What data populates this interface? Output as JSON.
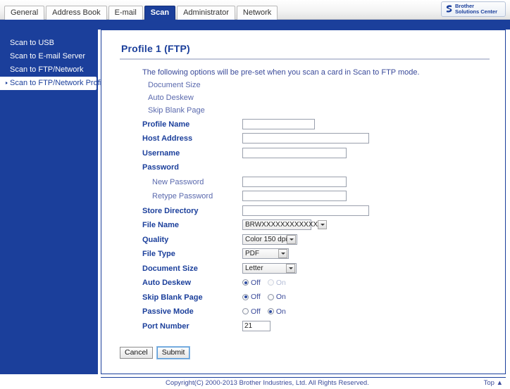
{
  "header": {
    "tabs": [
      {
        "label": "General",
        "active": false
      },
      {
        "label": "Address Book",
        "active": false
      },
      {
        "label": "E-mail",
        "active": false
      },
      {
        "label": "Scan",
        "active": true
      },
      {
        "label": "Administrator",
        "active": false
      },
      {
        "label": "Network",
        "active": false
      }
    ],
    "logo": {
      "line1": "Brother",
      "line2": "Solutions Center"
    }
  },
  "sidebar": {
    "items": [
      {
        "label": "Scan to USB",
        "active": false
      },
      {
        "label": "Scan to E-mail Server",
        "active": false
      },
      {
        "label": "Scan to FTP/Network",
        "active": false
      },
      {
        "label": "Scan to FTP/Network Profile",
        "active": true
      }
    ]
  },
  "main": {
    "title": "Profile 1 (FTP)",
    "intro": "The following options will be pre-set when you scan a card in Scan to FTP mode.",
    "intro_items": [
      "Document Size",
      "Auto Deskew",
      "Skip Blank Page"
    ],
    "fields": {
      "profile_name": {
        "label": "Profile Name",
        "value": "",
        "placeholder": ""
      },
      "host_address": {
        "label": "Host Address",
        "value": "",
        "placeholder": ""
      },
      "username": {
        "label": "Username",
        "value": "",
        "placeholder": ""
      },
      "password": {
        "label": "Password"
      },
      "new_password": {
        "label": "New Password",
        "value": "",
        "placeholder": ""
      },
      "retype_password": {
        "label": "Retype Password",
        "value": "",
        "placeholder": ""
      },
      "store_directory": {
        "label": "Store Directory",
        "value": "",
        "placeholder": ""
      },
      "file_name": {
        "label": "File Name",
        "value": "BRWXXXXXXXXXXXX"
      },
      "quality": {
        "label": "Quality",
        "value": "Color 150 dpi"
      },
      "file_type": {
        "label": "File Type",
        "value": "PDF"
      },
      "document_size": {
        "label": "Document Size",
        "value": "Letter"
      },
      "auto_deskew": {
        "label": "Auto Deskew",
        "off_label": "Off",
        "on_label": "On",
        "selected": "Off",
        "on_disabled": true
      },
      "skip_blank_page": {
        "label": "Skip Blank Page",
        "off_label": "Off",
        "on_label": "On",
        "selected": "Off",
        "on_disabled": false
      },
      "passive_mode": {
        "label": "Passive Mode",
        "off_label": "Off",
        "on_label": "On",
        "selected": "On",
        "on_disabled": false
      },
      "port_number": {
        "label": "Port Number",
        "value": "21",
        "placeholder": ""
      }
    },
    "buttons": {
      "cancel": "Cancel",
      "submit": "Submit"
    }
  },
  "footer": {
    "copyright": "Copyright(C) 2000-2013 Brother Industries, Ltd. All Rights Reserved.",
    "top_link": "Top ▲"
  },
  "colors": {
    "brand_blue": "#1b3f9b",
    "text_blue": "#3a4a9a",
    "sub_blue": "#5a69ad",
    "disabled": "#b3bcd6"
  }
}
